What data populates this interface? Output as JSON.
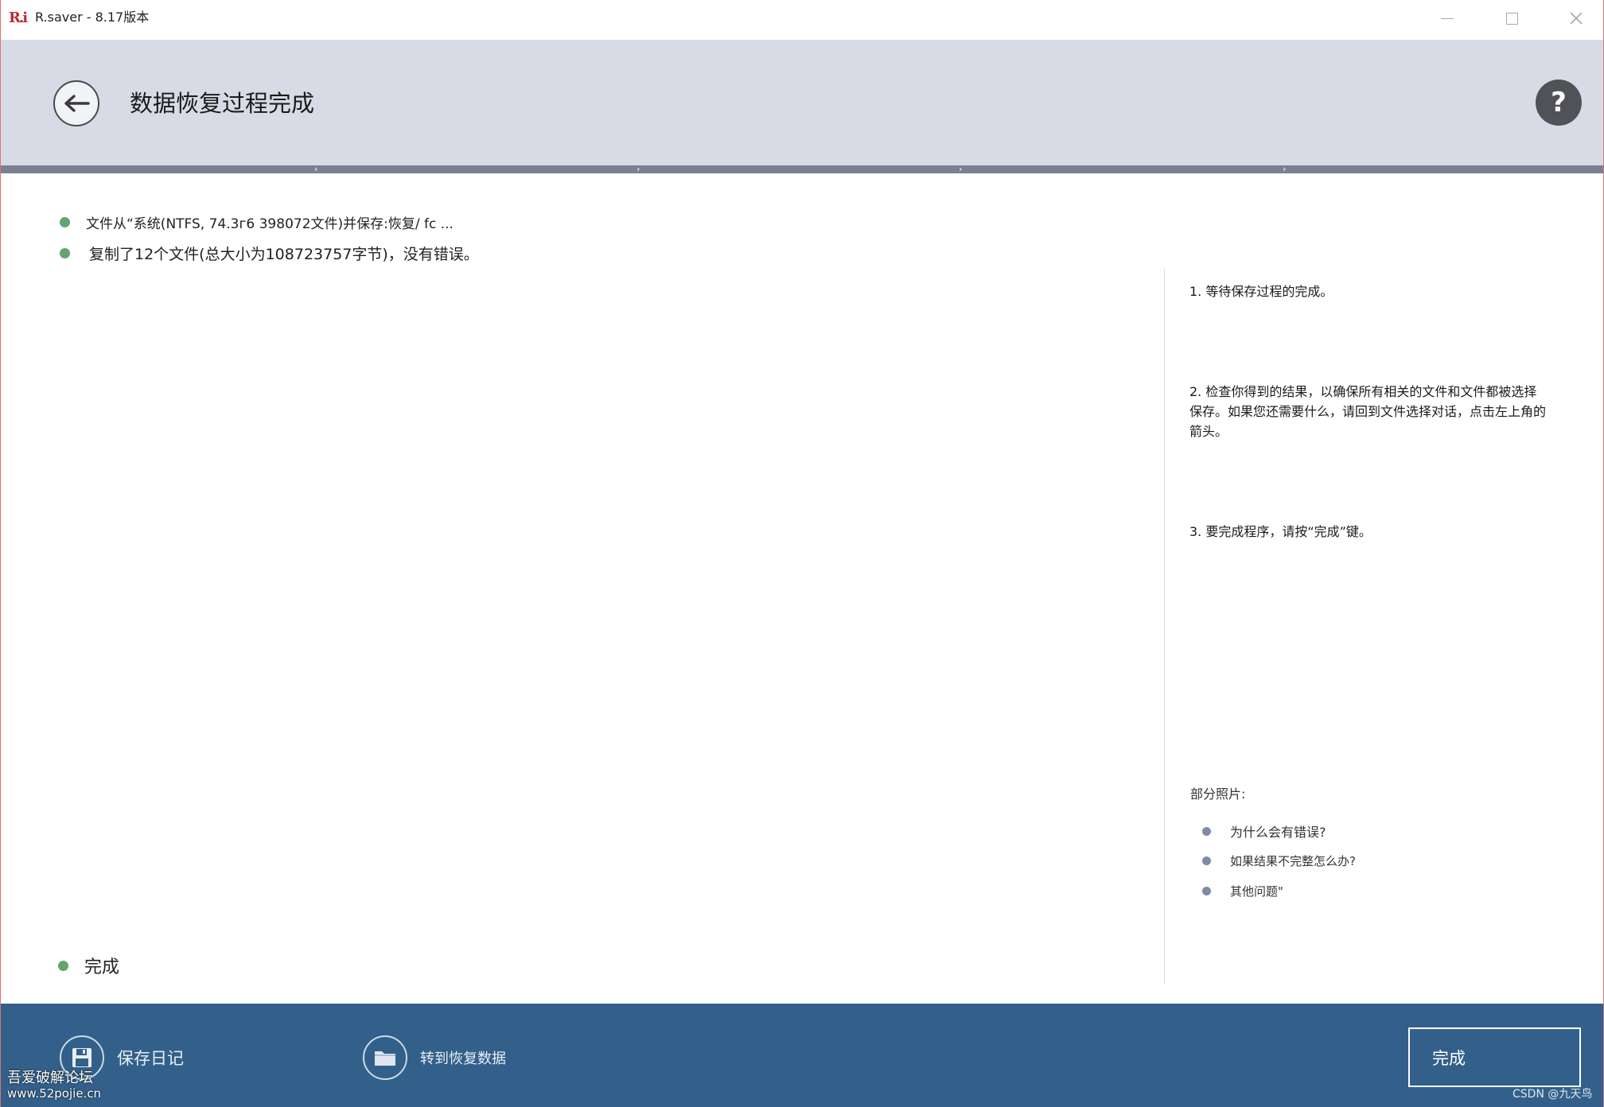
{
  "window": {
    "logo": "R.i",
    "title": "R.saver - 8.17版本",
    "controls": [
      "minimize-icon",
      "maximize-icon",
      "close-icon"
    ]
  },
  "header": {
    "back_icon": "arrow-left-icon",
    "title": "数据恢复过程完成",
    "help_label": "?"
  },
  "log": {
    "line1": "文件从“系统(NTFS, 74.3г6 398072文件)并保存:恢复/ fc ...",
    "line2": "复制了12个文件(总大小为108723757字节)，没有错误。",
    "done": "完成"
  },
  "info": {
    "step1": "1. 等待保存过程的完成。",
    "step2": "2. 检查你得到的结果，以确保所有相关的文件和文件都被选择保存。如果您还需要什么，请回到文件选择对话，点击左上角的箭头。",
    "step3": "3. 要完成程序，请按“完成”键。",
    "photos_label": "部分照片:",
    "faq": [
      "为什么会有错误?",
      "如果结果不完整怎么办?",
      "其他问题\""
    ]
  },
  "footer": {
    "save_log": "保存日记",
    "goto_recovered": "转到恢复数据",
    "finish": "完成",
    "watermark_name": "吾爱破解论坛",
    "watermark_url": "www.52pojie.cn",
    "csdn": "CSDN @九天鸟"
  },
  "colors": {
    "header_bg": "#d8dbe6",
    "footer_bg": "#32608a",
    "status_green": "#65a46e"
  }
}
